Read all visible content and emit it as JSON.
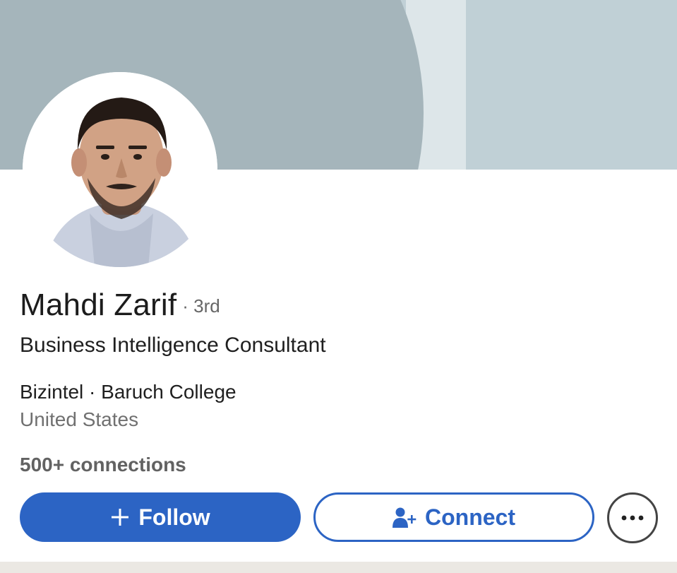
{
  "profile": {
    "name": "Mahdi Zarif",
    "degree": "· 3rd",
    "headline": "Business Intelligence Consultant",
    "company_line": "Bizintel · Baruch College",
    "location": "United States",
    "connections": "500+ connections"
  },
  "actions": {
    "follow_label": "Follow",
    "connect_label": "Connect",
    "follow_icon": "plus-icon",
    "connect_icon": "add-person-icon",
    "more_icon": "more-horizontal-icon"
  },
  "colors": {
    "primary_blue": "#2c64c4",
    "cover_dark": "#a5b5bb",
    "cover_light": "#c0d0d6"
  }
}
